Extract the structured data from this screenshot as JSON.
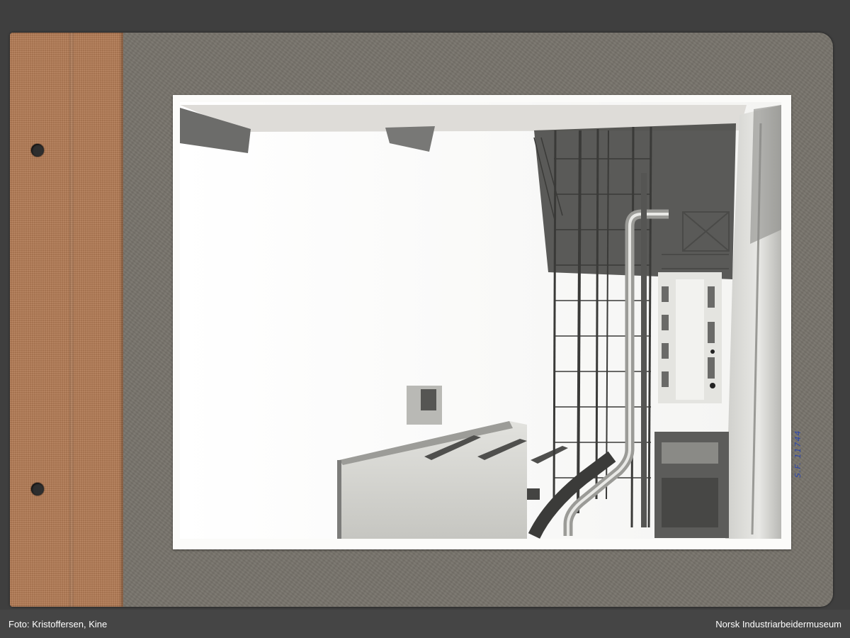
{
  "photo": {
    "catalog_number": "S.F. 11744"
  },
  "caption_bar": {
    "credit": "Foto: Kristoffersen, Kine",
    "museum": "Norsk Industriarbeidermuseum"
  }
}
